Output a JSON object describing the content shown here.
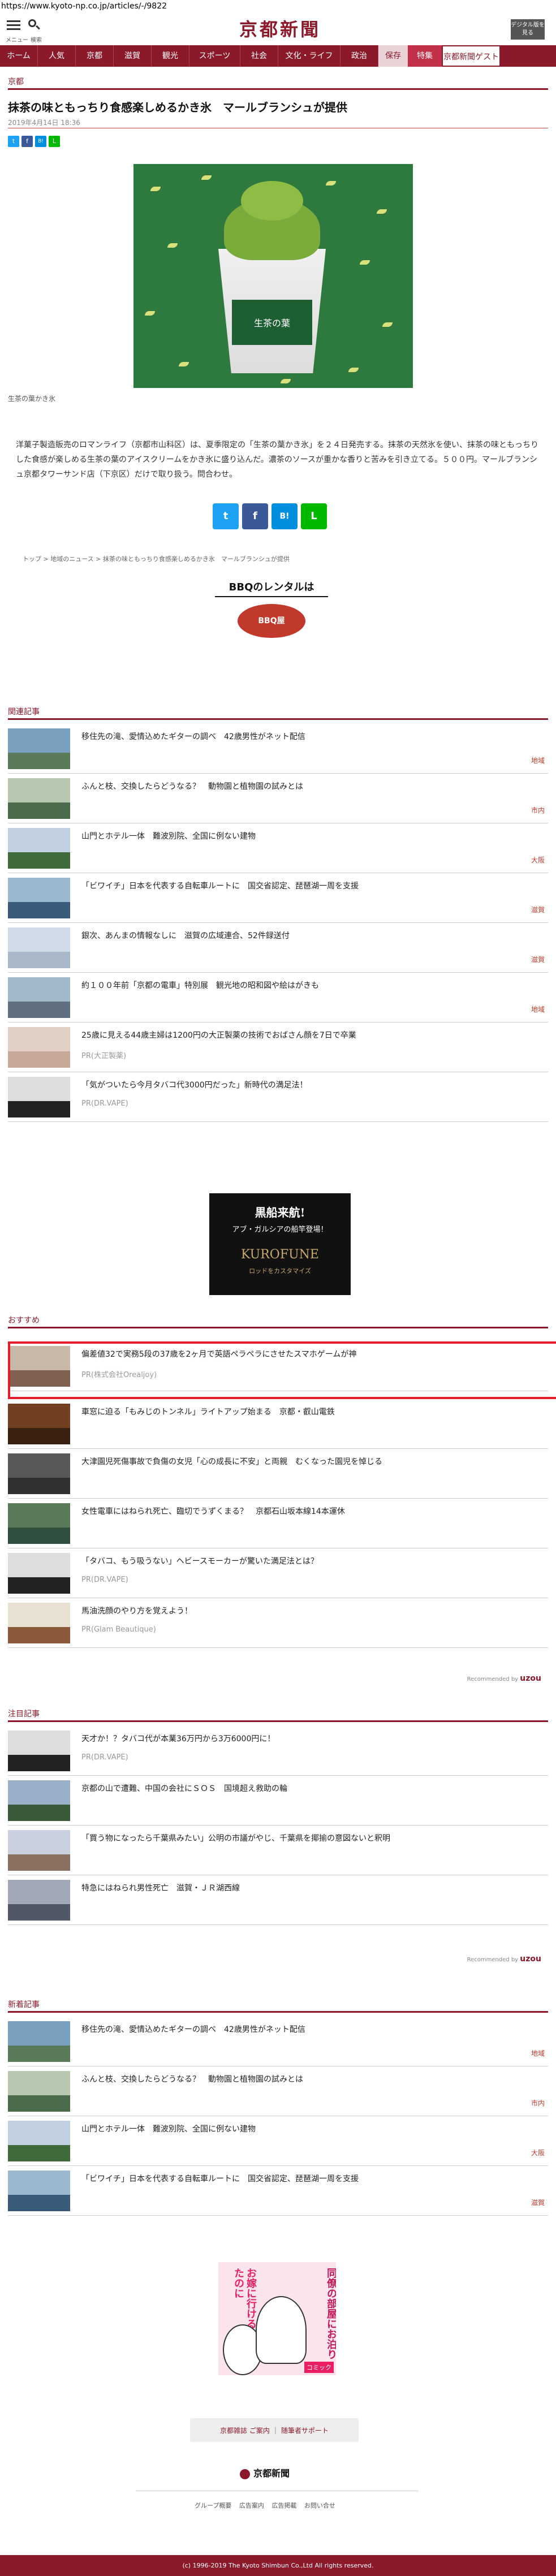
{
  "url": "https://www.kyoto-np.co.jp/articles/-/9822",
  "header": {
    "menu_label": "メニュー",
    "search_label": "検索",
    "logo": "京都新聞",
    "digital_button": "デジタル版を見る"
  },
  "nav": [
    "ホーム",
    "人気",
    "京都",
    "滋賀",
    "観光",
    "スポーツ",
    "社会",
    "文化・ライフ",
    "政治",
    "保存",
    "特集",
    "京都新聞ゲスト"
  ],
  "article": {
    "section": "京都",
    "title": "抹茶の味ともっちり食感楽しめるかき氷　マールブランシュが提供",
    "date": "2019年4月14日 18:36",
    "share": [
      "t",
      "f",
      "B!",
      "L"
    ],
    "image_caption": "生茶の葉かき氷",
    "cup_text": "生茶の葉",
    "body": "洋菓子製造販売のロマンライフ（京都市山科区）は、夏季限定の「生茶の葉かき氷」を２４日発売する。抹茶の天然氷を使い、抹茶の味ともっちりした食感が楽しめる生茶の葉のアイスクリームをかき氷に盛り込んだ。濃茶のソースが重かな香りと苦みを引き立てる。５００円。マールブランシュ京都タワーサンド店（下京区）だけで取り扱う。問合わせ。",
    "breadcrumb": [
      "トップ",
      "地域のニュース",
      "抹茶の味ともっちり食感楽しめるかき氷　マールブランシュが提供"
    ]
  },
  "ad1": {
    "title": "BBQのレンタルは",
    "badge": "BBQ屋"
  },
  "related": {
    "heading": "関連記事",
    "items": [
      {
        "title": "移住先の滝、愛情込めたギターの調べ　42歳男性がネット配信",
        "tag": "地域"
      },
      {
        "title": "ふんと枝、交換したらどうなる？　動物園と植物園の試みとは",
        "tag": "市内"
      },
      {
        "title": "山門とホテル一体　難波別院、全国に例ない建物",
        "tag": "大阪"
      },
      {
        "title": "「ビワイチ」日本を代表する自転車ルートに　国交省認定、琵琶湖一周を支援",
        "tag": "滋賀"
      },
      {
        "title": "銀次、あんまの情報なしに　滋賀の広域連合、52件録送付",
        "tag": "滋賀"
      },
      {
        "title": "約１００年前「京都の電車」特別展　観光地の昭和図や絵はがきも",
        "tag": "地域"
      },
      {
        "title": "25歳に見える44歳主婦は1200円の大正製薬の技術でおばさん顔を7日で卒業",
        "pr": "PR(大正製薬)"
      },
      {
        "title": "「気がついたら今月タバコ代3000円だった」新時代の満足法！",
        "pr": "PR(DR.VAPE)"
      }
    ]
  },
  "ad2": {
    "line1": "黒船来航!",
    "line2": "アブ・ガルシアの船竿登場！",
    "brand": "KUROFUNE",
    "sub": "ロッドをカスタマイズ"
  },
  "recommended": {
    "heading": "おすすめ",
    "items": [
      {
        "title": "偏差値32で実務5段の37歳を2ヶ月で英語ペラペラにさせたスマホゲームが神",
        "pr": "PR(株式会社Orealjoy)"
      },
      {
        "title": "車窓に迫る「もみじのトンネル」ライトアップ始まる　京都・叡山電鉄"
      },
      {
        "title": "大津園児死傷事故で負傷の女児「心の成長に不安」と両親　むくなった園児を悼じる"
      },
      {
        "title": "女性電車にはねられ死亡、臨切でうずくまる？　京都石山坂本線14本運休"
      },
      {
        "title": "「タバコ、もう吸うない」ヘビースモーカーが驚いた満足法とは？",
        "pr": "PR(DR.VAPE)"
      },
      {
        "title": "馬油洗顔のやり方を覚えよう！",
        "pr": "PR(Glam Beautique)"
      }
    ],
    "recommended_by": "Recommended by",
    "brand": "uzou"
  },
  "noted": {
    "heading": "注目記事",
    "items": [
      {
        "title": "天才か！？タバコ代が本業36万円から3万6000円に！",
        "pr": "PR(DR.VAPE)"
      },
      {
        "title": "京都の山で遭難、中国の会社にＳＯＳ　国境超え救助の輪"
      },
      {
        "title": "「買う物になったら千葉県みたい」公明の市議がやじ、千葉県を揶揄の意図ないと釈明"
      },
      {
        "title": "特急にはねられ男性死亡　滋賀・ＪＲ湖西線"
      }
    ],
    "recommended_by": "Recommended by",
    "brand": "uzou"
  },
  "latest": {
    "heading": "新着記事",
    "items": [
      {
        "title": "移住先の滝、愛情込めたギターの調べ　42歳男性がネット配信",
        "tag": "地域"
      },
      {
        "title": "ふんと枝、交換したらどうなる？　動物園と植物園の試みとは",
        "tag": "市内"
      },
      {
        "title": "山門とホテル一体　難波別院、全国に例ない建物",
        "tag": "大阪"
      },
      {
        "title": "「ビワイチ」日本を代表する自転車ルートに　国交省認定、琵琶湖一周を支援",
        "tag": "滋賀"
      }
    ]
  },
  "ad3": {
    "col1": "お嫁に行けると思ってたのに",
    "col2": "同僚の部屋にお泊り",
    "label": "コミック"
  },
  "footer": {
    "btn1": "京都雑誌 ご案内",
    "btn2": "随筆者サポート",
    "logo": "京都新聞",
    "links": "グループ概要 広告案内 広告掲載 お問い合せ",
    "copyright": "(c) 1996-2019 The Kyoto Shimbun Co.,Ltd All rights reserved."
  },
  "colors": {
    "brand": "#8c1929",
    "highlight": "#e11d2b",
    "tag": "#c0392b"
  }
}
